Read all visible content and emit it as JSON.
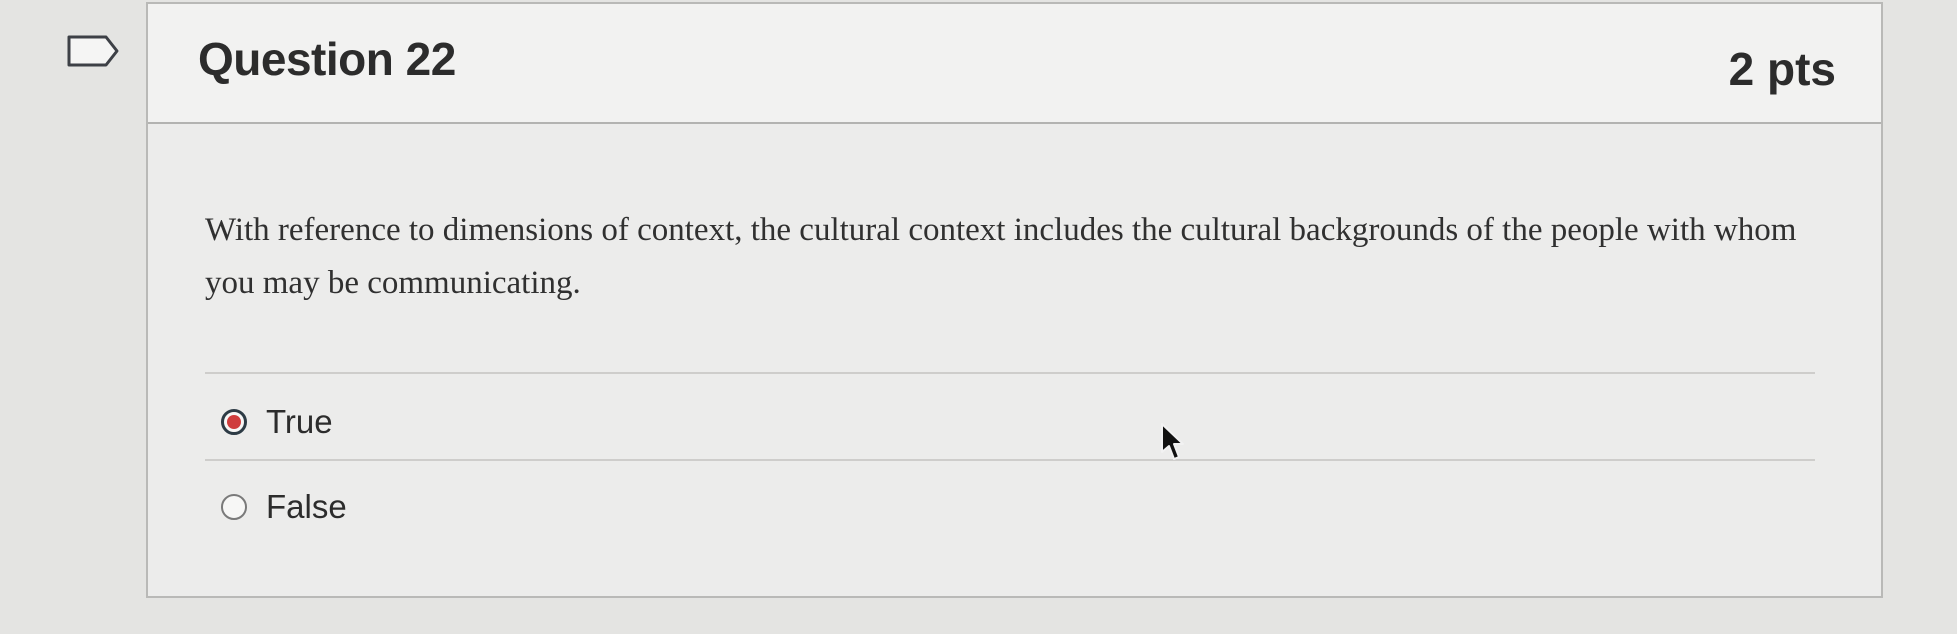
{
  "question": {
    "title": "Question 22",
    "points": "2 pts",
    "text": "With reference to dimensions of context, the cultural context includes the cultural backgrounds of the people with whom you may be communicating.",
    "flag_icon": "bookmark-flag-icon"
  },
  "answers": [
    {
      "label": "True",
      "selected": true
    },
    {
      "label": "False",
      "selected": false
    }
  ],
  "colors": {
    "selected_radio": "#cf3d3d",
    "text": "#2c2c2c"
  }
}
